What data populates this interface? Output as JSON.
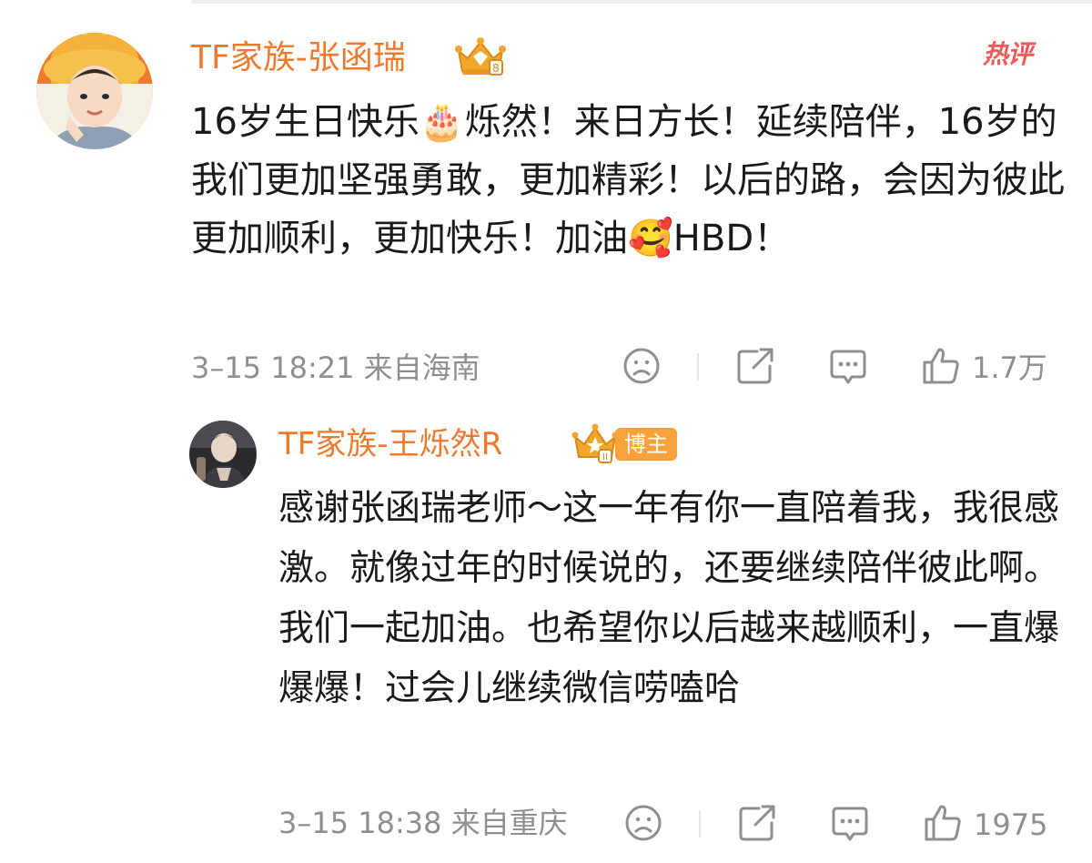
{
  "main_comment": {
    "username": "TF家族-张函瑞",
    "hot_tag": "热评",
    "text": "16岁生日快乐🎂烁然！来日方长！延续陪伴，16岁的我们更加坚强勇敢，更加精彩！以后的路，会因为彼此更加顺利，更加快乐！加油🥰HBD！",
    "meta": "3–15 18:21 来自海南",
    "like_count": "1.7万",
    "icons": {
      "avatar": "avatar-photo",
      "crown": "crown-badge-icon",
      "dislike": "sad-face-icon",
      "share": "share-icon",
      "reply": "comment-bubble-icon",
      "like": "thumbs-up-icon"
    }
  },
  "reply": {
    "username": "TF家族-王烁然R",
    "owner_badge": "博主",
    "text": "感谢张函瑞老师～这一年有你一直陪着我，我很感激。就像过年的时候说的，还要继续陪伴彼此啊。我们一起加油。也希望你以后越来越顺利，一直爆爆爆！过会儿继续微信唠嗑哈",
    "meta": "3–15 18:38 来自重庆",
    "like_count": "1975",
    "icons": {
      "avatar": "avatar-photo",
      "crown": "crown-badge-icon",
      "dislike": "sad-face-icon",
      "share": "share-icon",
      "reply": "comment-bubble-icon",
      "like": "thumbs-up-icon"
    }
  },
  "colors": {
    "username": "#ee7a2f",
    "hot_tag": "#f05a5a",
    "meta": "#8f8f8f",
    "owner_badge": "#f7a23a",
    "crown": "#f3a62c"
  }
}
